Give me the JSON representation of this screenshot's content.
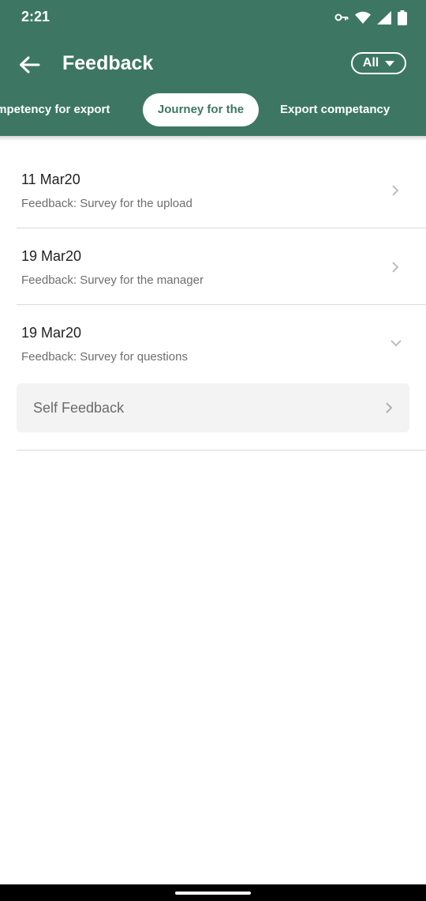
{
  "status": {
    "time": "2:21",
    "icons": [
      "vpn-key-icon",
      "wifi-icon",
      "signal-icon",
      "battery-icon"
    ]
  },
  "toolbar": {
    "title": "Feedback",
    "filter_label": "All",
    "back_icon": "arrow-left-icon",
    "filter_icon": "caret-down-icon"
  },
  "tabs": [
    {
      "label": "ompetency for export",
      "active": false
    },
    {
      "label": "Journey for the",
      "active": true
    },
    {
      "label": "Export competancy",
      "active": false
    }
  ],
  "items": [
    {
      "date": "11 Mar20",
      "subtitle": "Feedback: Survey for the upload",
      "state": "collapsed"
    },
    {
      "date": "19 Mar20",
      "subtitle": "Feedback: Survey for the manager",
      "state": "collapsed"
    },
    {
      "date": "19 Mar20",
      "subtitle": "Feedback: Survey for questions",
      "state": "expanded",
      "children": [
        {
          "label": "Self Feedback"
        }
      ]
    }
  ],
  "colors": {
    "header": "#3d7764",
    "active_tab_text": "#3d7764",
    "self_feedback_bg": "#f3f3f3"
  }
}
